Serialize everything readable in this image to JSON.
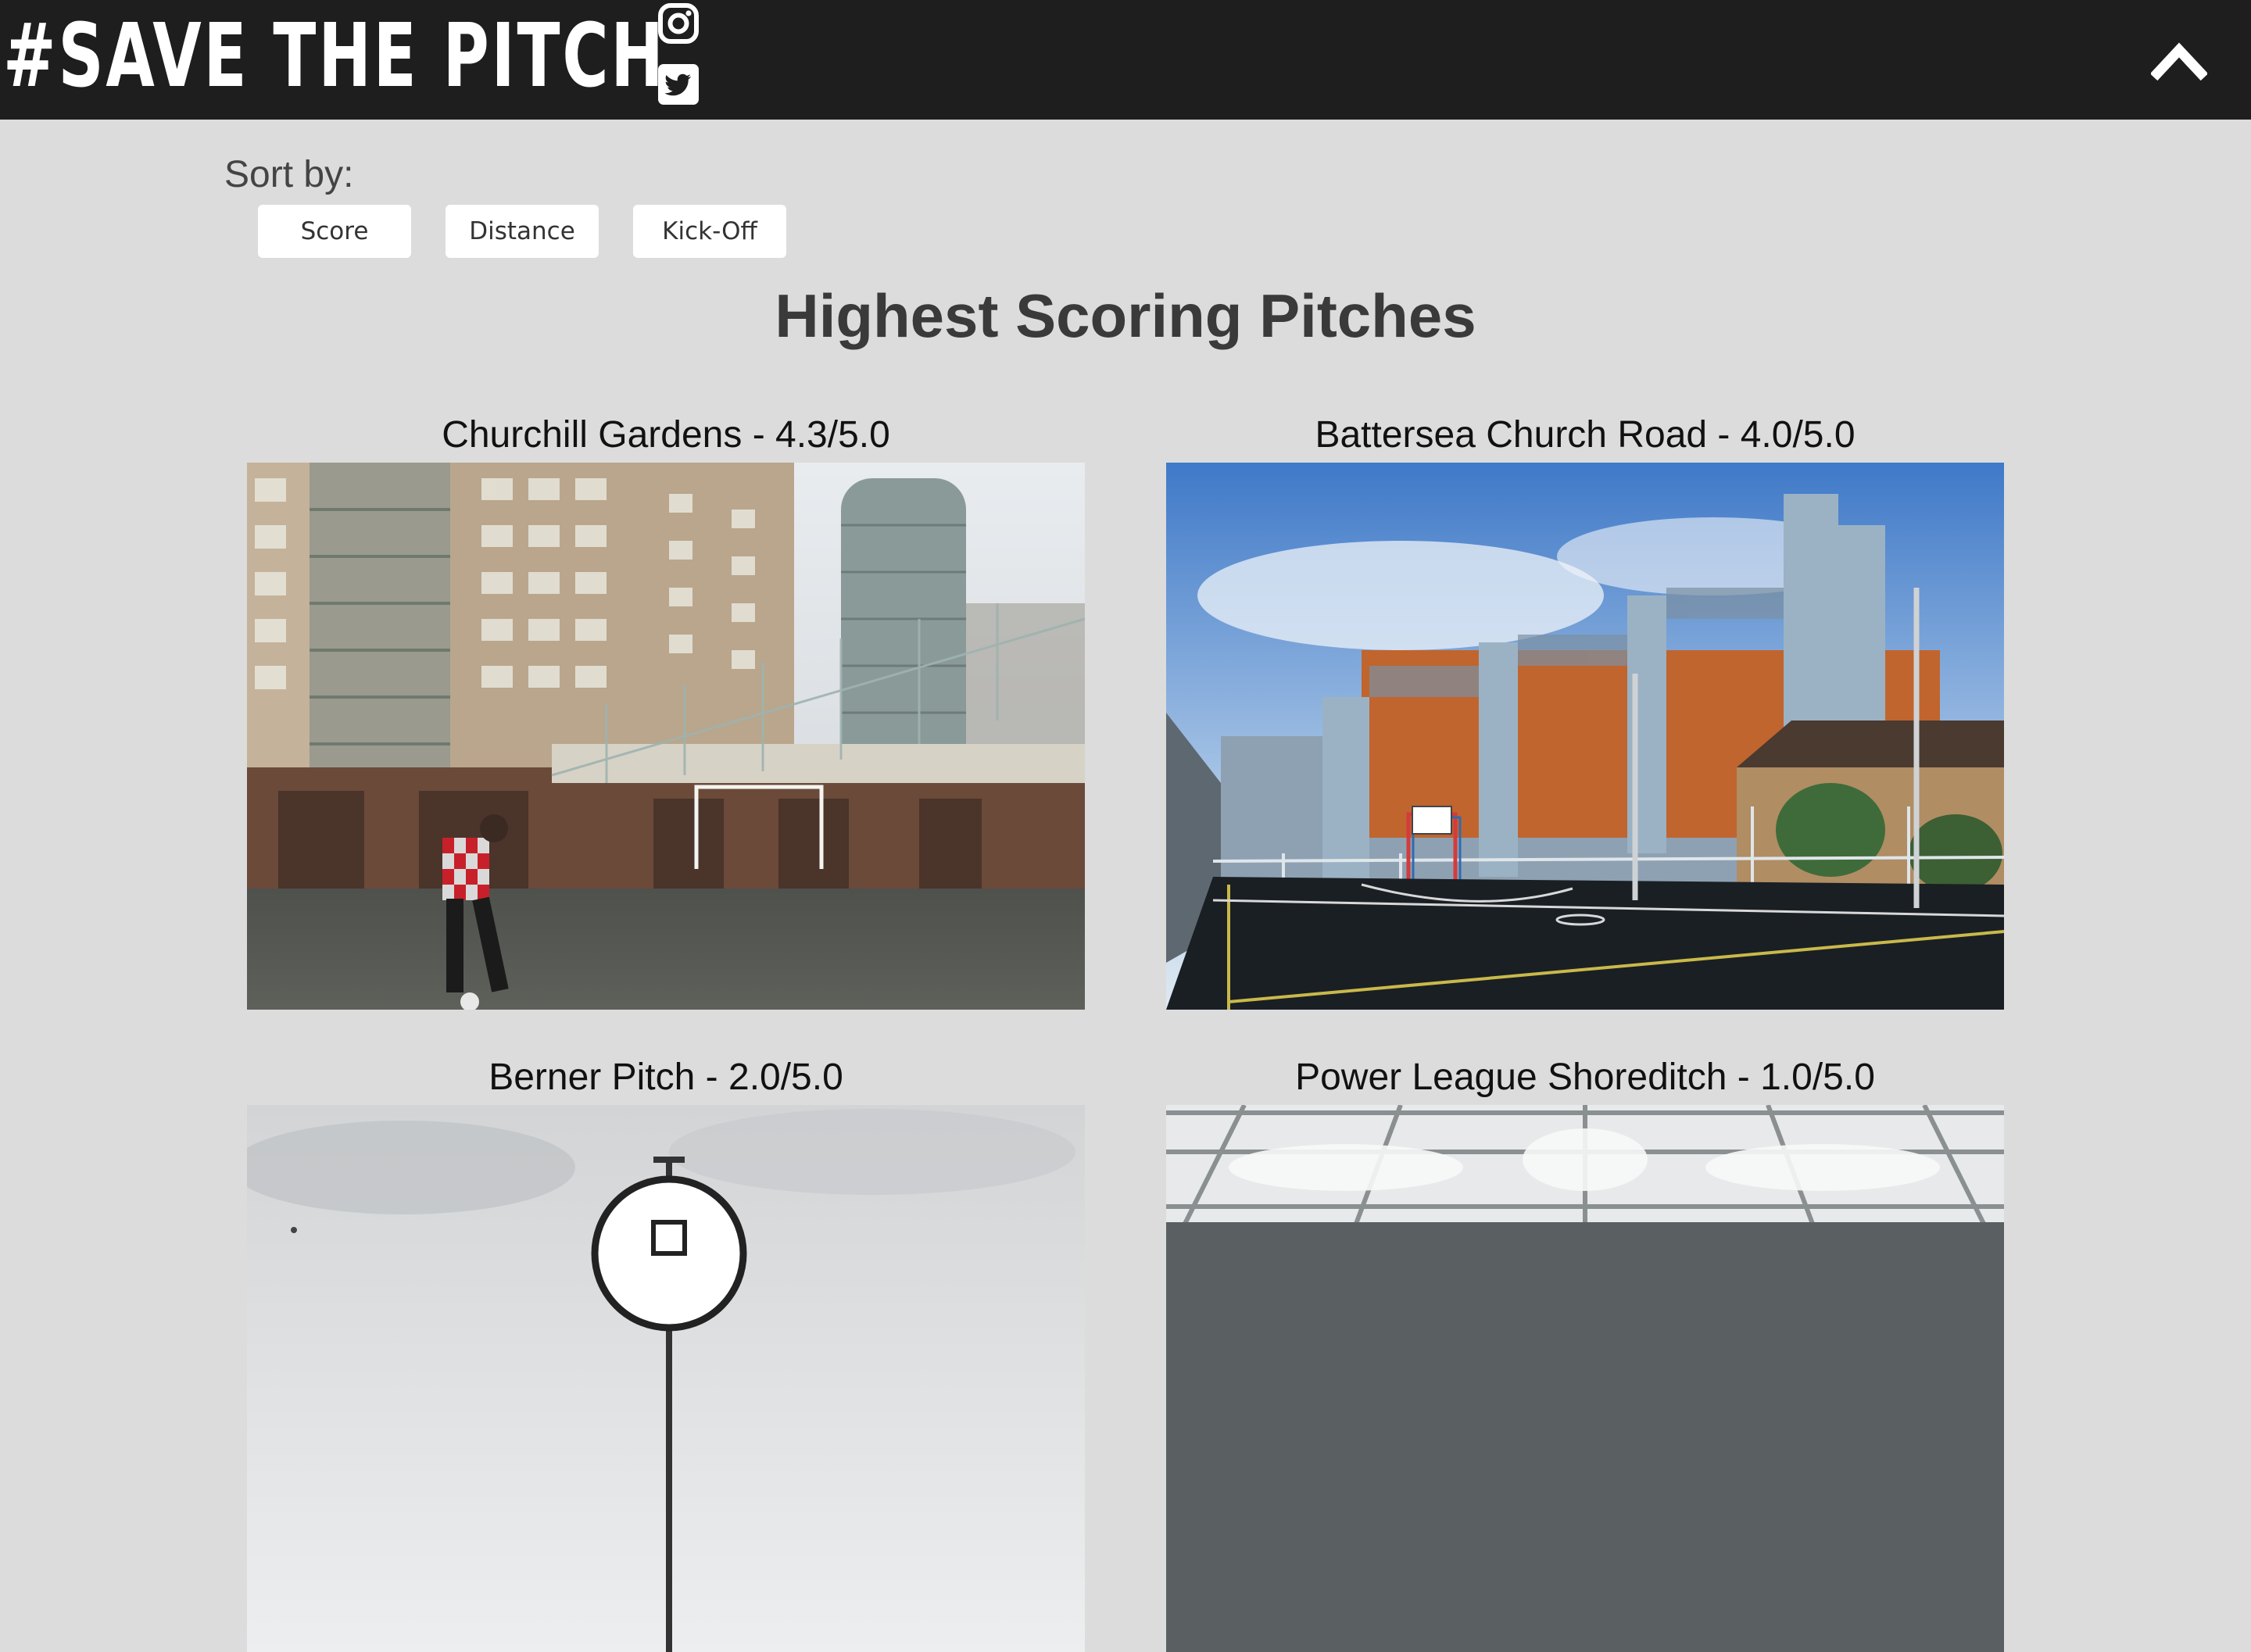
{
  "header": {
    "brand": "#SAVE THE PITCH",
    "social": [
      {
        "icon": "instagram-icon"
      },
      {
        "icon": "twitter-icon"
      }
    ],
    "collapse_icon": "chevron-up-icon"
  },
  "sort": {
    "label": "Sort by:",
    "options": [
      "Score",
      "Distance",
      "Kick-Off"
    ]
  },
  "main": {
    "title": "Highest Scoring Pitches",
    "pitches": [
      {
        "title": "Churchill Gardens - 4.3/5.0"
      },
      {
        "title": "Battersea Church Road - 4.0/5.0"
      },
      {
        "title": "Berner Pitch - 2.0/5.0"
      },
      {
        "title": "Power League Shoreditch - 1.0/5.0"
      }
    ]
  },
  "colors": {
    "header_bg": "#1e1e1e",
    "page_bg": "#dcdcdc",
    "button_bg": "#ffffff"
  }
}
